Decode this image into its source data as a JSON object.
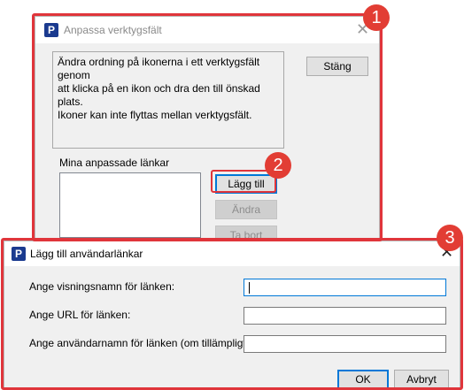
{
  "dialog1": {
    "title": "Anpassa verktygsfält",
    "description_lines": [
      "Ändra ordning på ikonerna i ett verktygsfält genom",
      "att klicka på en ikon och dra den till önskad plats.",
      "Ikoner kan inte flyttas mellan verktygsfält."
    ],
    "close_label": "Stäng",
    "links_label": "Mina anpassade länkar",
    "add_label": "Lägg till",
    "edit_label": "Ändra",
    "remove_label": "Ta bort",
    "logo_letter": "P"
  },
  "dialog2": {
    "title": "Lägg till användarlänkar",
    "logo_letter": "P",
    "fields": [
      {
        "label": "Ange visningsnamn för länken:",
        "value": ""
      },
      {
        "label": "Ange URL för länken:",
        "value": ""
      },
      {
        "label": "Ange användarnamn för länken (om tillämpligt):",
        "value": ""
      }
    ],
    "ok_label": "OK",
    "cancel_label": "Avbryt"
  },
  "close_glyph": "✕",
  "badges": [
    "1",
    "2",
    "3"
  ],
  "colors": {
    "highlight": "#e0353b",
    "badge": "#e23d34",
    "logo": "#1a3a8f",
    "dialog_bg": "#f0f0f0"
  },
  "icons": {
    "logo": "p-logo-icon",
    "close": "close-icon"
  }
}
